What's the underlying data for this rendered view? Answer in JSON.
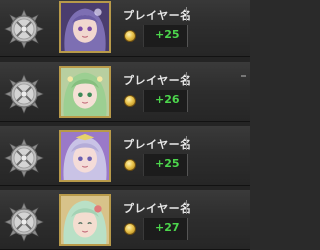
{
  "rows": [
    {
      "name": "プレイヤー名",
      "score": "+25",
      "character": "purple-hair-girl",
      "colors": {
        "hair": "#7d6fb3",
        "bg": "#4a3d6e",
        "skin": "#f1d7cf"
      }
    },
    {
      "name": "プレイヤー名",
      "score": "+26",
      "character": "green-hair-girl",
      "colors": {
        "hair": "#9ccf92",
        "bg": "#b8cfa0",
        "skin": "#f5e0d6"
      }
    },
    {
      "name": "プレイヤー名",
      "score": "+25",
      "character": "silver-hair-girl",
      "colors": {
        "hair": "#c9c3e6",
        "bg": "#9a79c8",
        "skin": "#f4dcd8"
      }
    },
    {
      "name": "プレイヤー名",
      "score": "+27",
      "character": "mint-hair-girl",
      "colors": {
        "hair": "#b9e0c6",
        "bg": "#d8c38a",
        "skin": "#f4ddd0"
      }
    }
  ],
  "theme": {
    "score_color": "#4cd64c",
    "name_color": "#e6e6e6",
    "frame_gold": "#b89a4a"
  }
}
